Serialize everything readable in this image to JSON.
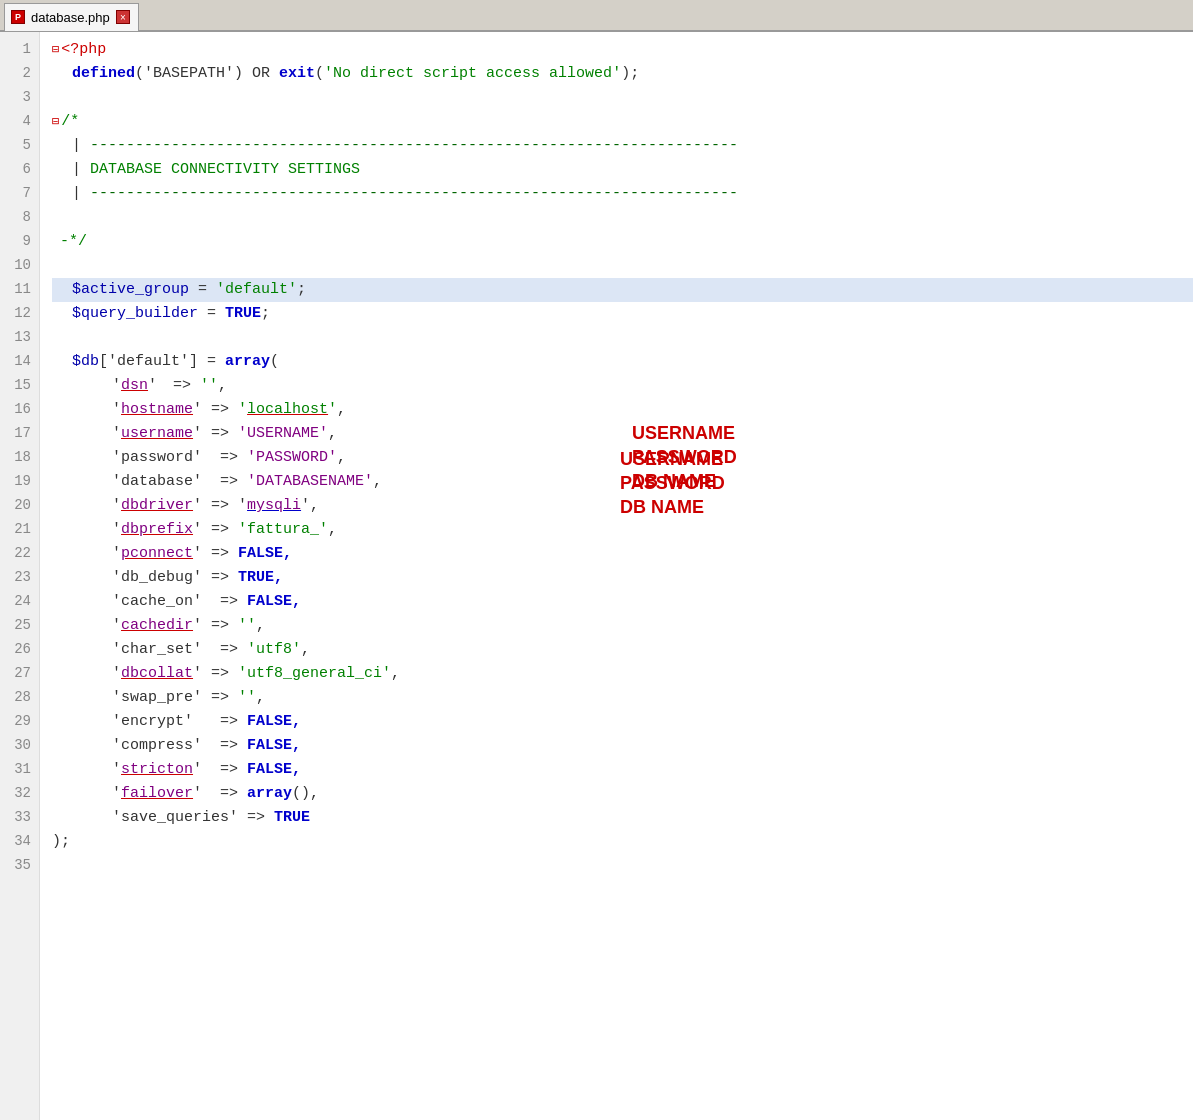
{
  "tab": {
    "label": "database.php",
    "icon": "php-icon",
    "close_label": "×"
  },
  "lines": [
    {
      "num": 1,
      "content": "php_open"
    },
    {
      "num": 2,
      "content": "defined_line"
    },
    {
      "num": 3,
      "content": "empty"
    },
    {
      "num": 4,
      "content": "comment_open"
    },
    {
      "num": 5,
      "content": "comment_dashes1"
    },
    {
      "num": 6,
      "content": "comment_text"
    },
    {
      "num": 7,
      "content": "comment_dashes2"
    },
    {
      "num": 8,
      "content": "empty"
    },
    {
      "num": 9,
      "content": "comment_close"
    },
    {
      "num": 10,
      "content": "empty"
    },
    {
      "num": 11,
      "content": "active_group",
      "highlighted": true
    },
    {
      "num": 12,
      "content": "query_builder"
    },
    {
      "num": 13,
      "content": "empty"
    },
    {
      "num": 14,
      "content": "db_array"
    },
    {
      "num": 15,
      "content": "dsn"
    },
    {
      "num": 16,
      "content": "hostname"
    },
    {
      "num": 17,
      "content": "username"
    },
    {
      "num": 18,
      "content": "password"
    },
    {
      "num": 19,
      "content": "database"
    },
    {
      "num": 20,
      "content": "dbdriver"
    },
    {
      "num": 21,
      "content": "dbprefix"
    },
    {
      "num": 22,
      "content": "pconnect"
    },
    {
      "num": 23,
      "content": "db_debug"
    },
    {
      "num": 24,
      "content": "cache_on"
    },
    {
      "num": 25,
      "content": "cachedir"
    },
    {
      "num": 26,
      "content": "char_set"
    },
    {
      "num": 27,
      "content": "dbcollat"
    },
    {
      "num": 28,
      "content": "swap_pre"
    },
    {
      "num": 29,
      "content": "encrypt"
    },
    {
      "num": 30,
      "content": "compress"
    },
    {
      "num": 31,
      "content": "stricton"
    },
    {
      "num": 32,
      "content": "failover"
    },
    {
      "num": 33,
      "content": "save_queries"
    },
    {
      "num": 34,
      "content": "close_array"
    },
    {
      "num": 35,
      "content": "empty"
    }
  ],
  "annotations": {
    "username_label": "USERNAME",
    "password_label": "PASSWORD",
    "dbname_label": "DB NAME"
  }
}
